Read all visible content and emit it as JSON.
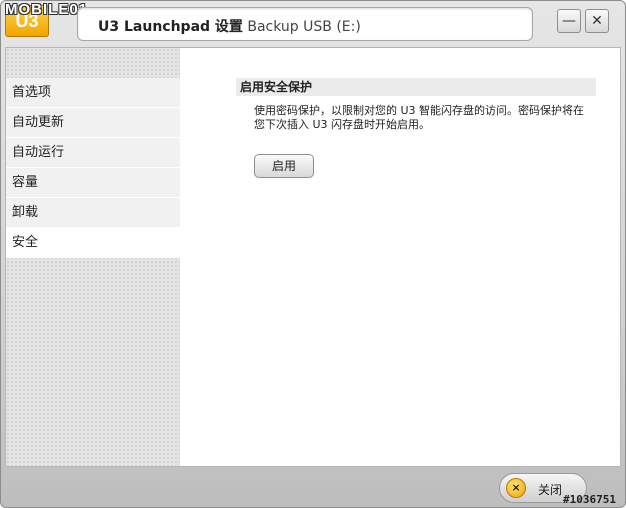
{
  "watermark": {
    "top": "MOBILE01",
    "bottom": "#1036751"
  },
  "logo": {
    "text": "U3"
  },
  "title": {
    "app": "U3 Launchpad 设置",
    "device": "Backup USB (E:)"
  },
  "window_controls": {
    "minimize": "—",
    "close": "✕"
  },
  "sidebar": {
    "items": [
      {
        "label": "首选项"
      },
      {
        "label": "自动更新"
      },
      {
        "label": "自动运行"
      },
      {
        "label": "容量"
      },
      {
        "label": "卸载"
      },
      {
        "label": "安全",
        "active": true
      }
    ]
  },
  "security": {
    "heading": "启用安全保护",
    "description": "使用密码保护，以限制对您的 U3 智能闪存盘的访问。密码保护将在您下次插入 U3 闪存盘时开始启用。",
    "enable_label": "启用"
  },
  "footer": {
    "close_label": "关闭",
    "close_icon": "×"
  },
  "colors": {
    "accent": "#f2a500",
    "sidebar_bg": "#e4e4e4",
    "active_item": "#ffffff"
  }
}
